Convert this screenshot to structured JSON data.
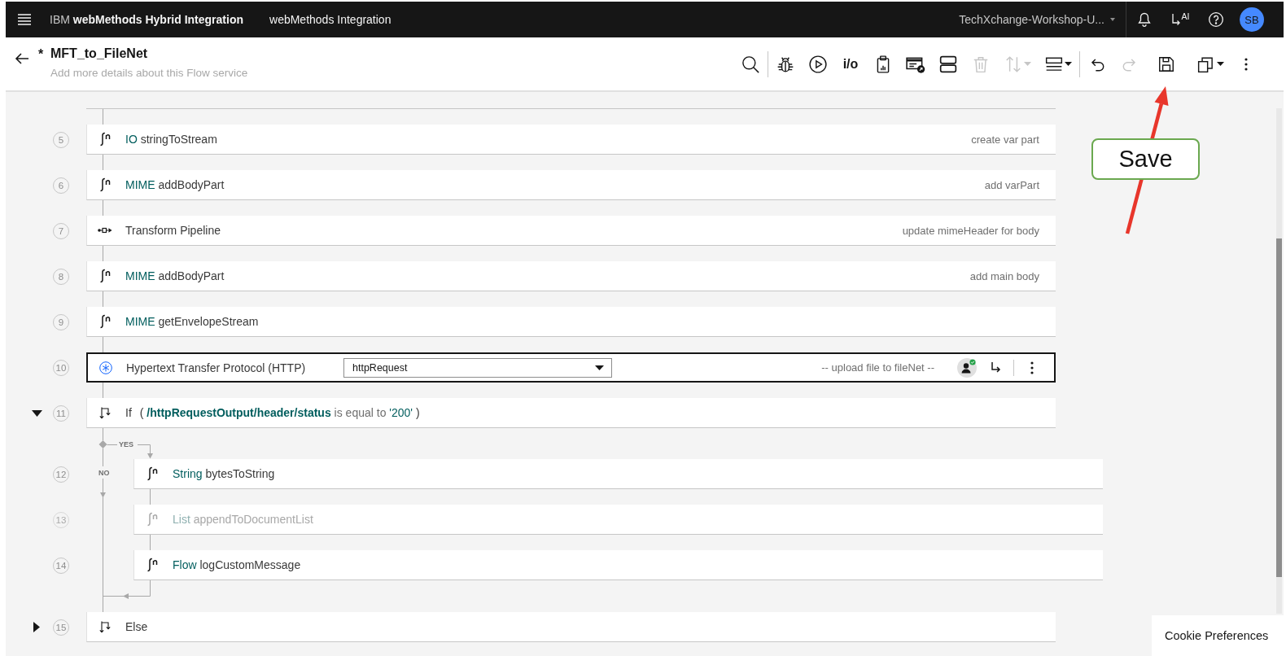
{
  "header": {
    "brand": "IBM **webMethods Hybrid Integration**",
    "product": "webMethods Integration",
    "tenant": "TechXchange-Workshop-U...",
    "ai_label": "AI",
    "avatar": "SB"
  },
  "service": {
    "unsaved_mark": "*",
    "title": "MFT_to_FileNet",
    "description": {
      "placeholder": "Add more details about this Flow service"
    }
  },
  "toolbar": {
    "groups": [
      [
        {
          "kind": "search",
          "disabled": false,
          "menu": false
        }
      ],
      [
        {
          "kind": "debug",
          "disabled": false,
          "menu": false
        },
        {
          "kind": "run",
          "disabled": false,
          "menu": false
        },
        {
          "kind": "io",
          "label": "i/o",
          "disabled": false,
          "menu": false
        },
        {
          "kind": "report",
          "disabled": false,
          "menu": false
        },
        {
          "kind": "card",
          "disabled": false,
          "menu": false
        },
        {
          "kind": "rows",
          "disabled": false,
          "menu": false
        },
        {
          "kind": "delete",
          "disabled": true,
          "menu": false
        },
        {
          "kind": "sort",
          "disabled": true,
          "menu": true
        },
        {
          "kind": "layout",
          "disabled": false,
          "menu": true
        }
      ],
      [
        {
          "kind": "undo",
          "disabled": false,
          "menu": false
        },
        {
          "kind": "redo",
          "disabled": true,
          "menu": false
        },
        {
          "kind": "save",
          "disabled": false,
          "menu": false
        },
        {
          "kind": "copy",
          "disabled": false,
          "menu": true
        },
        {
          "kind": "more",
          "disabled": false,
          "menu": false
        }
      ]
    ]
  },
  "steps": [
    {
      "number": "5",
      "kind": "function",
      "package": "IO",
      "name": "stringToStream",
      "comment": "create var part",
      "disabled": false,
      "selected": false
    },
    {
      "number": "6",
      "kind": "function",
      "package": "MIME",
      "name": "addBodyPart",
      "comment": "add varPart",
      "disabled": false,
      "selected": false
    },
    {
      "number": "7",
      "kind": "transform",
      "name": "Transform Pipeline",
      "comment": "update mimeHeader for body",
      "disabled": false,
      "selected": false
    },
    {
      "number": "8",
      "kind": "function",
      "package": "MIME",
      "name": "addBodyPart",
      "comment": "add main body",
      "disabled": false,
      "selected": false
    },
    {
      "number": "9",
      "kind": "function",
      "package": "MIME",
      "name": "getEnvelopeStream",
      "disabled": false,
      "selected": false
    },
    {
      "number": "10",
      "kind": "connector",
      "name": "Hypertext Transfer Protocol (HTTP)",
      "operation": "httpRequest",
      "comment": "-- upload file to fileNet --",
      "disabled": false,
      "selected": true
    },
    {
      "number": "11",
      "kind": "if",
      "name": "If",
      "condition": {
        "open": "(",
        "path": "/httpRequestOutput/header/status",
        "operator": "is equal to",
        "value": "'200'",
        "close": ")"
      },
      "expanded": true,
      "yes_label": "YES",
      "no_label": "NO",
      "disabled": false,
      "selected": false,
      "children": [
        {
          "number": "12",
          "kind": "function",
          "package": "String",
          "name": "bytesToString",
          "disabled": false,
          "selected": false
        },
        {
          "number": "13",
          "kind": "function",
          "package": "List",
          "name": "appendToDocumentList",
          "disabled": true,
          "selected": false
        },
        {
          "number": "14",
          "kind": "function",
          "package": "Flow",
          "name": "logCustomMessage",
          "disabled": false,
          "selected": false
        }
      ]
    },
    {
      "number": "15",
      "kind": "else",
      "name": "Else",
      "expanded": false,
      "disabled": false,
      "selected": false
    }
  ],
  "annotation": {
    "callout": "Save"
  },
  "cookie_button": "Cookie Preferences"
}
